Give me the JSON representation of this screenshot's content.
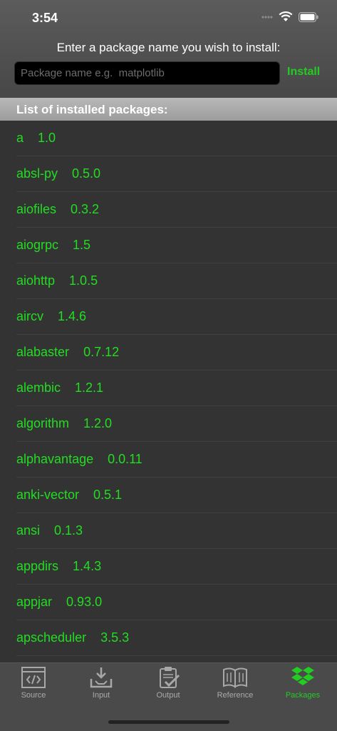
{
  "status_bar": {
    "time": "3:54"
  },
  "installer": {
    "prompt": "Enter a package name you wish to install:",
    "placeholder": "Package name e.g.  matplotlib",
    "value": "",
    "install_label": "Install"
  },
  "list_header": "List of installed packages:",
  "packages": [
    {
      "name": "a",
      "version": "1.0"
    },
    {
      "name": "absl-py",
      "version": "0.5.0"
    },
    {
      "name": "aiofiles",
      "version": "0.3.2"
    },
    {
      "name": "aiogrpc",
      "version": "1.5"
    },
    {
      "name": "aiohttp",
      "version": "1.0.5"
    },
    {
      "name": "aircv",
      "version": "1.4.6"
    },
    {
      "name": "alabaster",
      "version": "0.7.12"
    },
    {
      "name": "alembic",
      "version": "1.2.1"
    },
    {
      "name": "algorithm",
      "version": "1.2.0"
    },
    {
      "name": "alphavantage",
      "version": "0.0.11"
    },
    {
      "name": "anki-vector",
      "version": "0.5.1"
    },
    {
      "name": "ansi",
      "version": "0.1.3"
    },
    {
      "name": "appdirs",
      "version": "1.4.3"
    },
    {
      "name": "appjar",
      "version": "0.93.0"
    },
    {
      "name": "apscheduler",
      "version": "3.5.3"
    }
  ],
  "tabs": [
    {
      "label": "Source",
      "icon": "source-code-icon",
      "active": false
    },
    {
      "label": "Input",
      "icon": "input-tray-icon",
      "active": false
    },
    {
      "label": "Output",
      "icon": "clipboard-check-icon",
      "active": false
    },
    {
      "label": "Reference",
      "icon": "book-icon",
      "active": false
    },
    {
      "label": "Packages",
      "icon": "dropbox-icon",
      "active": true
    }
  ],
  "colors": {
    "accent_green": "#22dd22",
    "background": "#333333",
    "header": "#4f4f4f",
    "tab_inactive": "#aaaaaa"
  }
}
